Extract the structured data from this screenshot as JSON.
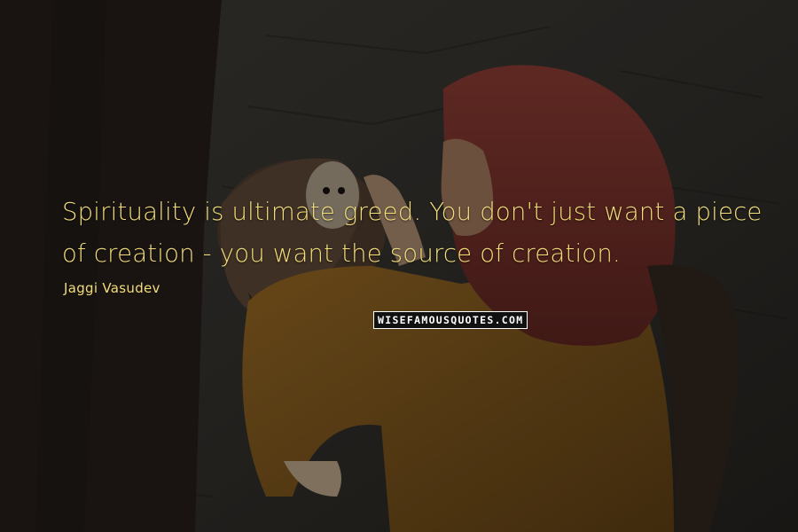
{
  "quote": {
    "text": "Spirituality is ultimate greed. You don't just want a piece of creation - you want the source of creation.",
    "author": "Jaggi Vasudev",
    "color": "#f2dd7a"
  },
  "watermark": {
    "text": "WISEFAMOUSQUOTES.COM"
  },
  "background": {
    "description_colors": {
      "wall": "#3b3833",
      "scarf": "#8a3b33",
      "jacket": "#9a6a22",
      "owl": "#5a4636"
    }
  }
}
